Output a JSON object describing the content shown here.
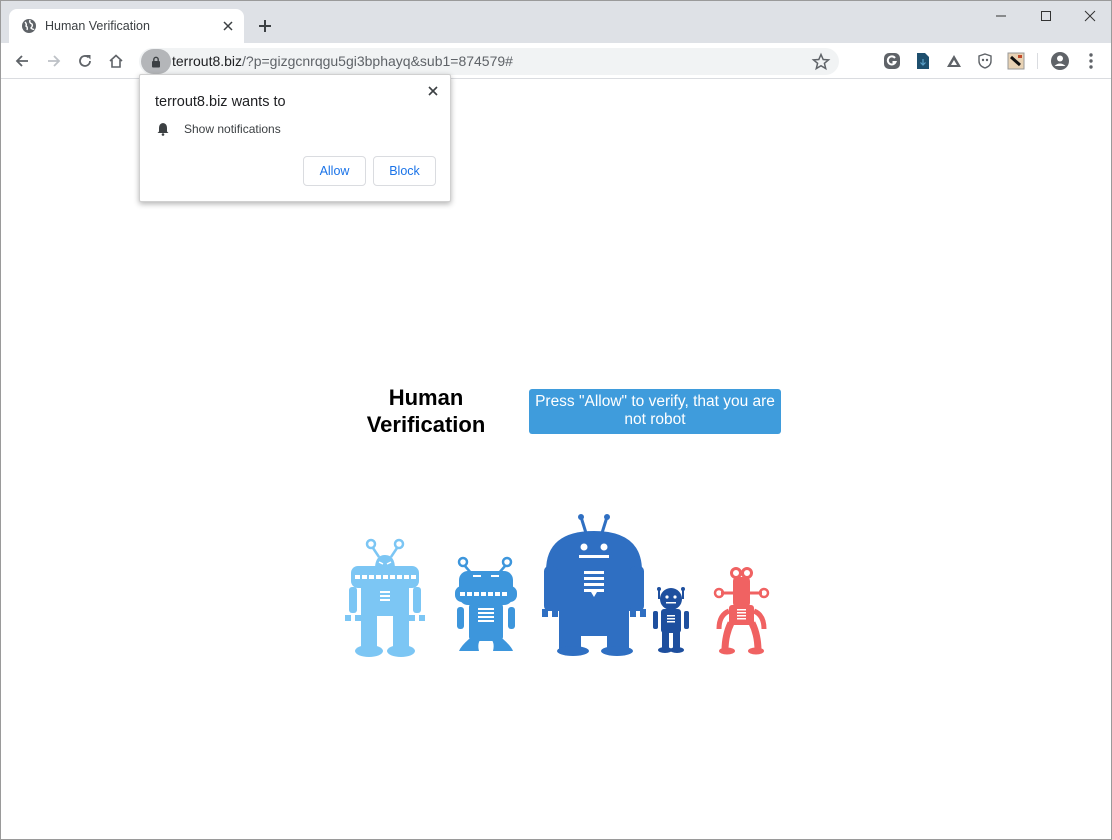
{
  "browser": {
    "tab": {
      "title": "Human Verification",
      "favicon": "globe-icon",
      "close_icon": "close-icon"
    },
    "new_tab_icon": "plus-icon",
    "window_controls": [
      "minimize-icon",
      "maximize-icon",
      "close-icon"
    ],
    "nav": {
      "back_icon": "arrow-left-icon",
      "forward_icon": "arrow-right-icon",
      "reload_icon": "reload-icon",
      "home_icon": "home-icon"
    },
    "omnibox": {
      "lock_icon": "lock-icon",
      "host": "terrout8.biz",
      "path": "/?p=gizgcnrqgu5gi3bphayq&sub1=874579#",
      "bookmark_icon": "star-icon"
    },
    "extensions": [
      {
        "name": "grammarly-extension",
        "color": "#5f6368"
      },
      {
        "name": "download-extension",
        "color": "#1e4f6e"
      },
      {
        "name": "triangle-extension",
        "color": "#5f6368"
      },
      {
        "name": "shield-extension",
        "color": "#5f6368"
      },
      {
        "name": "picture-extension",
        "color": "#c0c0c0"
      }
    ],
    "profile_icon": "account-icon",
    "menu_icon": "more-vert-icon"
  },
  "permission_popup": {
    "title": "terrout8.biz wants to",
    "permission_icon": "bell-icon",
    "permission_label": "Show notifications",
    "allow_label": "Allow",
    "block_label": "Block",
    "accent_color": "#1a73e8"
  },
  "page": {
    "heading_line1": "Human",
    "heading_line2": "Verification",
    "verify_text": "Press \"Allow\" to verify, that you are not robot",
    "verify_color": "#3f9cdc",
    "robots": [
      {
        "name": "robot-light-blue",
        "color": "#7cc6f4"
      },
      {
        "name": "robot-medium-blue",
        "color": "#3d96dc"
      },
      {
        "name": "robot-big-blue",
        "color": "#2f6fc2"
      },
      {
        "name": "robot-small-navy",
        "color": "#1e4f9e"
      },
      {
        "name": "robot-red",
        "color": "#f06262"
      }
    ]
  }
}
